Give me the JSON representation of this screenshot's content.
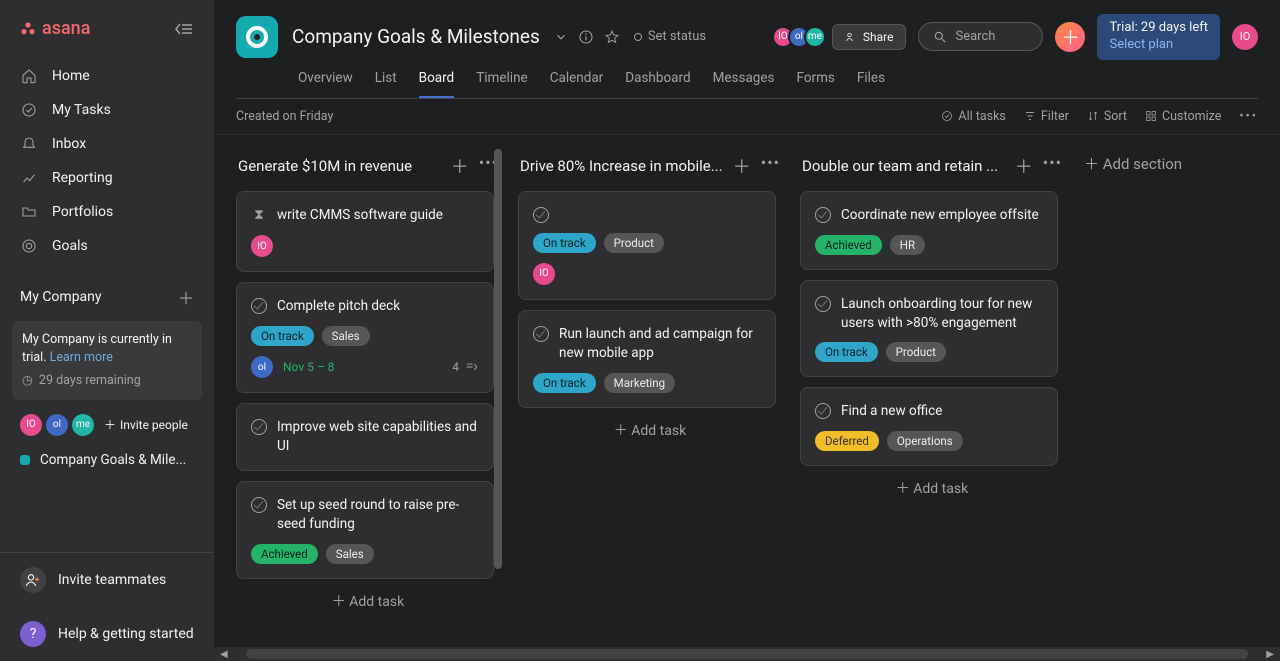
{
  "app": {
    "name": "asana"
  },
  "sidebar": {
    "nav": [
      {
        "label": "Home",
        "icon": "home-icon"
      },
      {
        "label": "My Tasks",
        "icon": "check-circle-icon"
      },
      {
        "label": "Inbox",
        "icon": "bell-icon"
      },
      {
        "label": "Reporting",
        "icon": "chart-icon"
      },
      {
        "label": "Portfolios",
        "icon": "folder-icon"
      },
      {
        "label": "Goals",
        "icon": "target-icon"
      }
    ],
    "workspace": "My Company",
    "trial_msg_a": "My Company is currently in trial. ",
    "trial_learn": "Learn more",
    "trial_remaining": "29 days remaining",
    "avatars": [
      "IO",
      "ol",
      "me"
    ],
    "invite_people": "Invite people",
    "project_name": "Company Goals & Mile...",
    "invite_teammates": "Invite teammates",
    "help": "Help & getting started"
  },
  "header": {
    "title": "Company Goals & Milestones",
    "set_status": "Set status",
    "share": "Share",
    "search_placeholder": "Search",
    "trial_line1": "Trial: 29 days left",
    "trial_line2": "Select plan",
    "user": "IO",
    "member_avatars": [
      "IO",
      "ol",
      "me"
    ]
  },
  "tabs": [
    "Overview",
    "List",
    "Board",
    "Timeline",
    "Calendar",
    "Dashboard",
    "Messages",
    "Forms",
    "Files"
  ],
  "active_tab": "Board",
  "toolbar": {
    "created": "Created on Friday",
    "all_tasks": "All tasks",
    "filter": "Filter",
    "sort": "Sort",
    "customize": "Customize"
  },
  "columns": [
    {
      "title": "Generate $10M in revenue",
      "cards": [
        {
          "icon": "hourglass",
          "title": "write CMMS software guide",
          "tags": [],
          "avatar": "IO",
          "av_class": "av-pink"
        },
        {
          "icon": "check",
          "title": "Complete pitch deck",
          "tags": [
            [
              "On track",
              "tag-ontrack"
            ],
            [
              "Sales",
              "tag-gray"
            ]
          ],
          "avatar": "ol",
          "av_class": "av-blue",
          "date": "Nov 5 – 8",
          "sub": "4",
          "sub_icon": true
        },
        {
          "icon": "check",
          "title": "Improve web site capabilities and UI",
          "tags": []
        },
        {
          "icon": "check",
          "title": "Set up seed round to raise pre-seed funding",
          "tags": [
            [
              "Achieved",
              "tag-achieved"
            ],
            [
              "Sales",
              "tag-gray"
            ]
          ]
        }
      ],
      "add_task": "Add task"
    },
    {
      "title": "Drive 80% Increase in mobile...",
      "cards": [
        {
          "icon": "check",
          "title": "",
          "tags": [
            [
              "On track",
              "tag-ontrack"
            ],
            [
              "Product",
              "tag-gray"
            ]
          ],
          "avatar": "IO",
          "av_class": "av-pink"
        },
        {
          "icon": "check",
          "title": "Run launch and ad campaign for new mobile app",
          "tags": [
            [
              "On track",
              "tag-ontrack"
            ],
            [
              "Marketing",
              "tag-gray"
            ]
          ]
        }
      ],
      "add_task": "Add task"
    },
    {
      "title": "Double our team and retain ...",
      "cards": [
        {
          "icon": "check",
          "title": "Coordinate new employee offsite",
          "tags": [
            [
              "Achieved",
              "tag-achieved"
            ],
            [
              "HR",
              "tag-gray"
            ]
          ]
        },
        {
          "icon": "check",
          "title": "Launch onboarding tour for new users with >80% engagement",
          "tags": [
            [
              "On track",
              "tag-ontrack"
            ],
            [
              "Product",
              "tag-gray"
            ]
          ]
        },
        {
          "icon": "check",
          "title": "Find a new office",
          "tags": [
            [
              "Deferred",
              "tag-deferred"
            ],
            [
              "Operations",
              "tag-gray"
            ]
          ]
        }
      ],
      "add_task": "Add task"
    }
  ],
  "add_section": "Add section"
}
